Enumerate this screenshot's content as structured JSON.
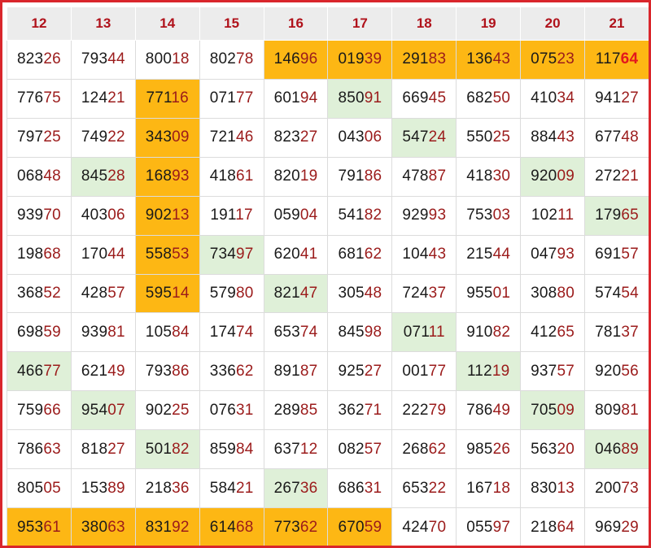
{
  "columns": [
    "12",
    "13",
    "14",
    "15",
    "16",
    "17",
    "18",
    "19",
    "20",
    "21"
  ],
  "rows": [
    [
      {
        "v": "82326"
      },
      {
        "v": "79344"
      },
      {
        "v": "80018"
      },
      {
        "v": "80278"
      },
      {
        "v": "14696",
        "hl": "orange"
      },
      {
        "v": "01939",
        "hl": "orange"
      },
      {
        "v": "29183",
        "hl": "orange"
      },
      {
        "v": "13643",
        "hl": "orange"
      },
      {
        "v": "07523",
        "hl": "orange"
      },
      {
        "v": "11764",
        "hl": "orange",
        "strong": true
      }
    ],
    [
      {
        "v": "77675"
      },
      {
        "v": "12421"
      },
      {
        "v": "77116",
        "hl": "orange"
      },
      {
        "v": "07177"
      },
      {
        "v": "60194"
      },
      {
        "v": "85091",
        "hl": "green"
      },
      {
        "v": "66945"
      },
      {
        "v": "68250"
      },
      {
        "v": "41034"
      },
      {
        "v": "94127"
      }
    ],
    [
      {
        "v": "79725"
      },
      {
        "v": "74922"
      },
      {
        "v": "34309",
        "hl": "orange"
      },
      {
        "v": "72146"
      },
      {
        "v": "82327"
      },
      {
        "v": "04306"
      },
      {
        "v": "54724",
        "hl": "green"
      },
      {
        "v": "55025"
      },
      {
        "v": "88443"
      },
      {
        "v": "67748"
      }
    ],
    [
      {
        "v": "06848"
      },
      {
        "v": "84528",
        "hl": "green"
      },
      {
        "v": "16893",
        "hl": "orange"
      },
      {
        "v": "41861"
      },
      {
        "v": "82019"
      },
      {
        "v": "79186"
      },
      {
        "v": "47887"
      },
      {
        "v": "41830"
      },
      {
        "v": "92009",
        "hl": "green"
      },
      {
        "v": "27221"
      }
    ],
    [
      {
        "v": "93970"
      },
      {
        "v": "40306"
      },
      {
        "v": "90213",
        "hl": "orange"
      },
      {
        "v": "19117"
      },
      {
        "v": "05904"
      },
      {
        "v": "54182"
      },
      {
        "v": "92993"
      },
      {
        "v": "75303"
      },
      {
        "v": "10211"
      },
      {
        "v": "17965",
        "hl": "green"
      }
    ],
    [
      {
        "v": "19868"
      },
      {
        "v": "17044"
      },
      {
        "v": "55853",
        "hl": "orange"
      },
      {
        "v": "73497",
        "hl": "green"
      },
      {
        "v": "62041"
      },
      {
        "v": "68162"
      },
      {
        "v": "10443"
      },
      {
        "v": "21544"
      },
      {
        "v": "04793"
      },
      {
        "v": "69157"
      }
    ],
    [
      {
        "v": "36852"
      },
      {
        "v": "42857"
      },
      {
        "v": "59514",
        "hl": "orange"
      },
      {
        "v": "57980"
      },
      {
        "v": "82147",
        "hl": "green"
      },
      {
        "v": "30548"
      },
      {
        "v": "72437"
      },
      {
        "v": "95501"
      },
      {
        "v": "30880"
      },
      {
        "v": "57454"
      }
    ],
    [
      {
        "v": "69859"
      },
      {
        "v": "93981"
      },
      {
        "v": "10584"
      },
      {
        "v": "17474"
      },
      {
        "v": "65374"
      },
      {
        "v": "84598"
      },
      {
        "v": "07111",
        "hl": "green"
      },
      {
        "v": "91082"
      },
      {
        "v": "41265"
      },
      {
        "v": "78137"
      }
    ],
    [
      {
        "v": "46677",
        "hl": "green"
      },
      {
        "v": "62149"
      },
      {
        "v": "79386"
      },
      {
        "v": "33662"
      },
      {
        "v": "89187"
      },
      {
        "v": "92527"
      },
      {
        "v": "00177"
      },
      {
        "v": "11219",
        "hl": "green"
      },
      {
        "v": "93757"
      },
      {
        "v": "92056"
      }
    ],
    [
      {
        "v": "75966"
      },
      {
        "v": "95407",
        "hl": "green"
      },
      {
        "v": "90225"
      },
      {
        "v": "07631"
      },
      {
        "v": "28985"
      },
      {
        "v": "36271"
      },
      {
        "v": "22279"
      },
      {
        "v": "78649"
      },
      {
        "v": "70509",
        "hl": "green"
      },
      {
        "v": "80981"
      }
    ],
    [
      {
        "v": "78663"
      },
      {
        "v": "81827"
      },
      {
        "v": "50182",
        "hl": "green"
      },
      {
        "v": "85984"
      },
      {
        "v": "63712"
      },
      {
        "v": "08257"
      },
      {
        "v": "26862"
      },
      {
        "v": "98526"
      },
      {
        "v": "56320"
      },
      {
        "v": "04689",
        "hl": "green"
      }
    ],
    [
      {
        "v": "80505"
      },
      {
        "v": "15389"
      },
      {
        "v": "21836"
      },
      {
        "v": "58421"
      },
      {
        "v": "26736",
        "hl": "green"
      },
      {
        "v": "68631"
      },
      {
        "v": "65322"
      },
      {
        "v": "16718"
      },
      {
        "v": "83013"
      },
      {
        "v": "20073"
      }
    ],
    [
      {
        "v": "95361",
        "hl": "orange"
      },
      {
        "v": "38063",
        "hl": "orange"
      },
      {
        "v": "83192",
        "hl": "orange"
      },
      {
        "v": "61468",
        "hl": "orange"
      },
      {
        "v": "77362",
        "hl": "orange"
      },
      {
        "v": "67059",
        "hl": "orange"
      },
      {
        "v": "42470"
      },
      {
        "v": "05597"
      },
      {
        "v": "21864"
      },
      {
        "v": "96929"
      }
    ]
  ],
  "colors": {
    "border": "#d9262c",
    "header_bg": "#ececec",
    "header_text": "#b0121b",
    "highlight_orange": "#fdb714",
    "highlight_green": "#dff0d8",
    "digit_head": "#1a1a1a",
    "digit_tail": "#9b1b1b",
    "digit_tail_strong": "#e3171d"
  }
}
